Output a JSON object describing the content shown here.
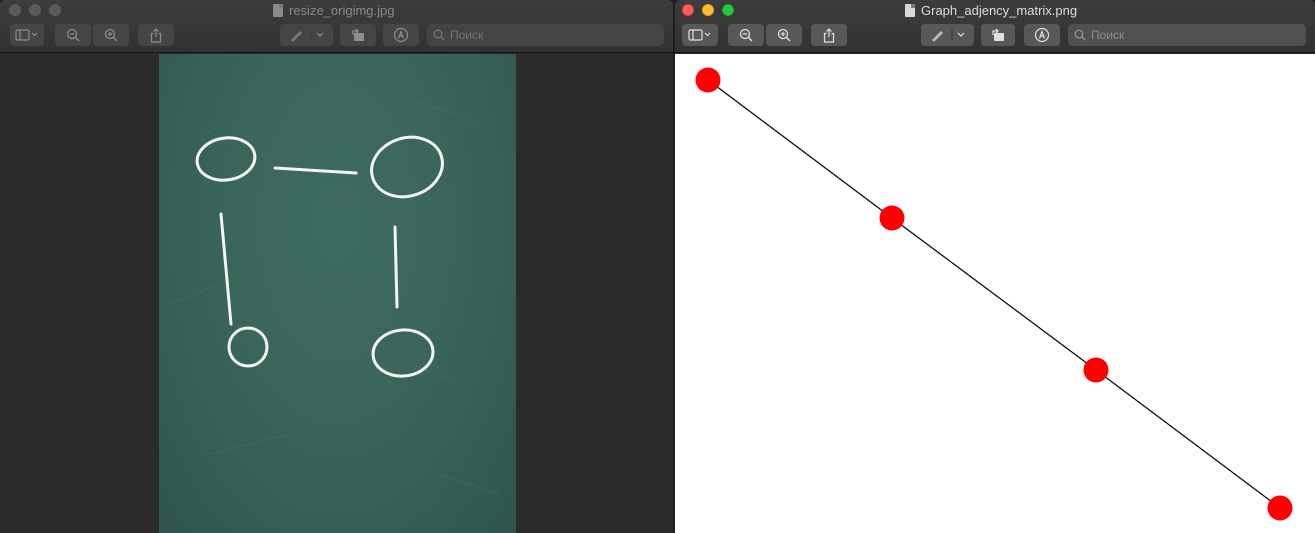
{
  "left_window": {
    "title": "resize_origimg.jpg",
    "search_placeholder": "Поиск",
    "active": false
  },
  "right_window": {
    "title": "Graph_adjency_matrix.png",
    "search_placeholder": "Поиск",
    "active": true
  },
  "photo": {
    "description_icon": "chalkboard-photo",
    "background_color": "#3a655b",
    "chalk_color": "#f2f2ee"
  },
  "graph_plot": {
    "node_color": "#ff0000",
    "edge_color": "#000000",
    "node_count": 4,
    "edge_count": 3
  },
  "colors": {
    "close": "#fe5f57",
    "minimize": "#febc2e",
    "maximize": "#28c840"
  }
}
